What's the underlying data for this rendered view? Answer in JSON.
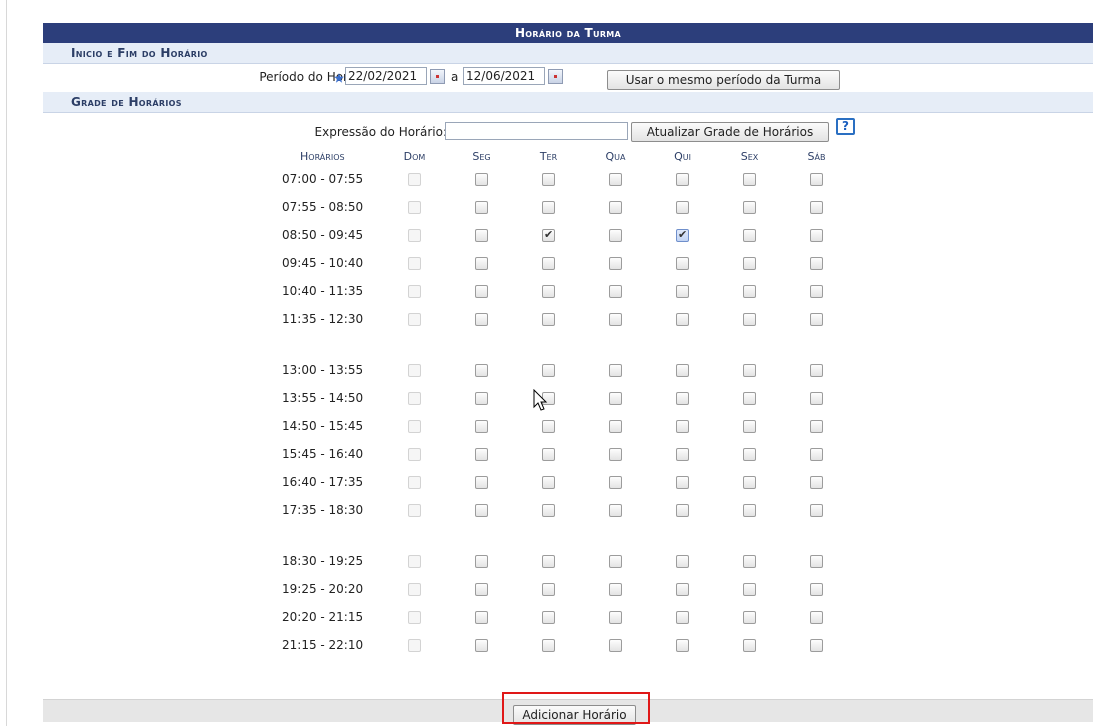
{
  "title": "Horário da Turma",
  "sections": {
    "inicio_fim": "Inicio e Fim do Horário",
    "grade": "Grade de Horários"
  },
  "periodo": {
    "label": "Período do Horário:",
    "inicio": "22/02/2021",
    "separator": "a",
    "fim": "12/06/2021",
    "mesmo_periodo_button": "Usar o mesmo período da Turma"
  },
  "expressao": {
    "label": "Expressão do Horário:",
    "value": "",
    "atualizar_button": "Atualizar Grade de Horários",
    "help": "?"
  },
  "grid": {
    "time_header": "Horários",
    "days": [
      "Dom",
      "Seg",
      "Ter",
      "Qua",
      "Qui",
      "Sex",
      "Sáb"
    ],
    "blocks": [
      [
        "07:00 - 07:55",
        "07:55 - 08:50",
        "08:50 - 09:45",
        "09:45 - 10:40",
        "10:40 - 11:35",
        "11:35 - 12:30"
      ],
      [
        "13:00 - 13:55",
        "13:55 - 14:50",
        "14:50 - 15:45",
        "15:45 - 16:40",
        "16:40 - 17:35",
        "17:35 - 18:30"
      ],
      [
        "18:30 - 19:25",
        "19:25 - 20:20",
        "20:20 - 21:15",
        "21:15 - 22:10"
      ]
    ],
    "checked": [
      {
        "slot": "08:50 - 09:45",
        "day": "Ter"
      },
      {
        "slot": "08:50 - 09:45",
        "day": "Qui"
      }
    ],
    "disabled_day": "Dom"
  },
  "footer": {
    "adicionar_button": "Adicionar Horário"
  },
  "colors": {
    "title_bar": "#2c3e7b",
    "section_bar": "#e6edf7",
    "highlight": "#e01818"
  }
}
